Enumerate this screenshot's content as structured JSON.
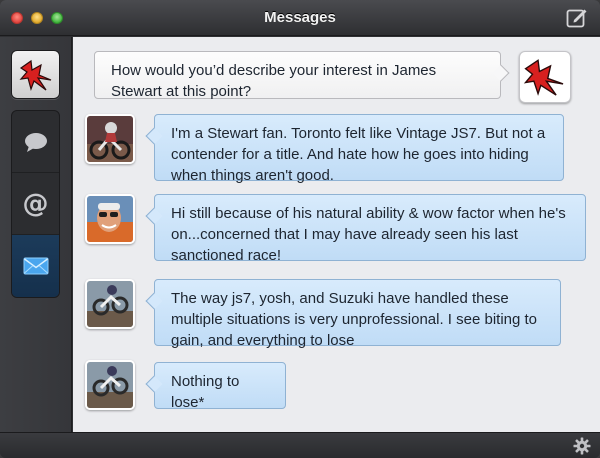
{
  "window": {
    "title": "Messages"
  },
  "icons": {
    "compose": "compose-icon",
    "account": "red-lightning-logo-icon",
    "chat": "speech-bubble-icon",
    "mentions": "at-sign-icon",
    "messages": "envelope-icon",
    "settings": "gear-icon"
  },
  "sidebar": {
    "mentions_glyph": "@"
  },
  "messages": [
    {
      "direction": "outgoing",
      "text": "How would you’d describe your interest in James Stewart at this point?"
    },
    {
      "direction": "incoming",
      "text": "I'm a Stewart fan. Toronto felt like Vintage JS7. But not a contender for a title. And hate how he goes into hiding when things aren't good."
    },
    {
      "direction": "incoming",
      "text": "Hi still because of his natural ability & wow factor when he's on...concerned that I may have already seen his last sanctioned race!"
    },
    {
      "direction": "incoming",
      "text": "The way js7, yosh, and Suzuki have handled these multiple situations is very unprofessional. I see biting to gain, and everything to lose"
    },
    {
      "direction": "incoming",
      "text": "Nothing to lose*"
    }
  ],
  "colors": {
    "incoming_bubble": "#c8e1f8",
    "outgoing_bubble": "#f6f6f7",
    "brand_red": "#d8201f",
    "selected_nav": "#1a3858"
  }
}
